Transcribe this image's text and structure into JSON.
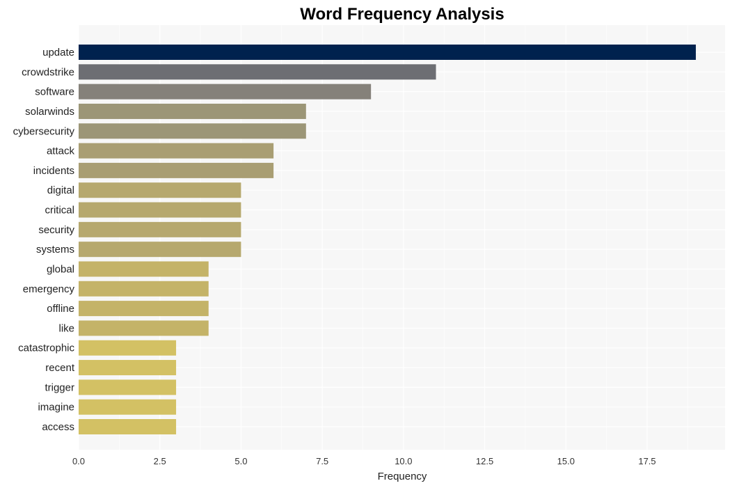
{
  "chart_data": {
    "type": "bar",
    "orientation": "horizontal",
    "title": "Word Frequency Analysis",
    "xlabel": "Frequency",
    "ylabel": "",
    "xlim": [
      0,
      19.8
    ],
    "xticks": [
      0,
      2.5,
      5,
      7.5,
      10,
      12.5,
      15,
      17.5
    ],
    "xtick_labels": [
      "0.0",
      "2.5",
      "5.0",
      "7.5",
      "10.0",
      "12.5",
      "15.0",
      "17.5"
    ],
    "grid": true,
    "categories": [
      "update",
      "crowdstrike",
      "software",
      "solarwinds",
      "cybersecurity",
      "attack",
      "incidents",
      "digital",
      "critical",
      "security",
      "systems",
      "global",
      "emergency",
      "offline",
      "like",
      "catastrophic",
      "recent",
      "trigger",
      "imagine",
      "access"
    ],
    "values": [
      19,
      11,
      9,
      7,
      7,
      6,
      6,
      5,
      5,
      5,
      5,
      4,
      4,
      4,
      4,
      3,
      3,
      3,
      3,
      3
    ],
    "colors": [
      "#00224e",
      "#6d6e73",
      "#85817a",
      "#9c9677",
      "#9c9677",
      "#a99e73",
      "#a99e73",
      "#b6a86e",
      "#b6a86e",
      "#b6a86e",
      "#b6a86e",
      "#c4b368",
      "#c4b368",
      "#c4b368",
      "#c4b368",
      "#d3c164",
      "#d3c164",
      "#d3c164",
      "#d3c164",
      "#d3c164"
    ],
    "background": "#f7f7f7"
  }
}
